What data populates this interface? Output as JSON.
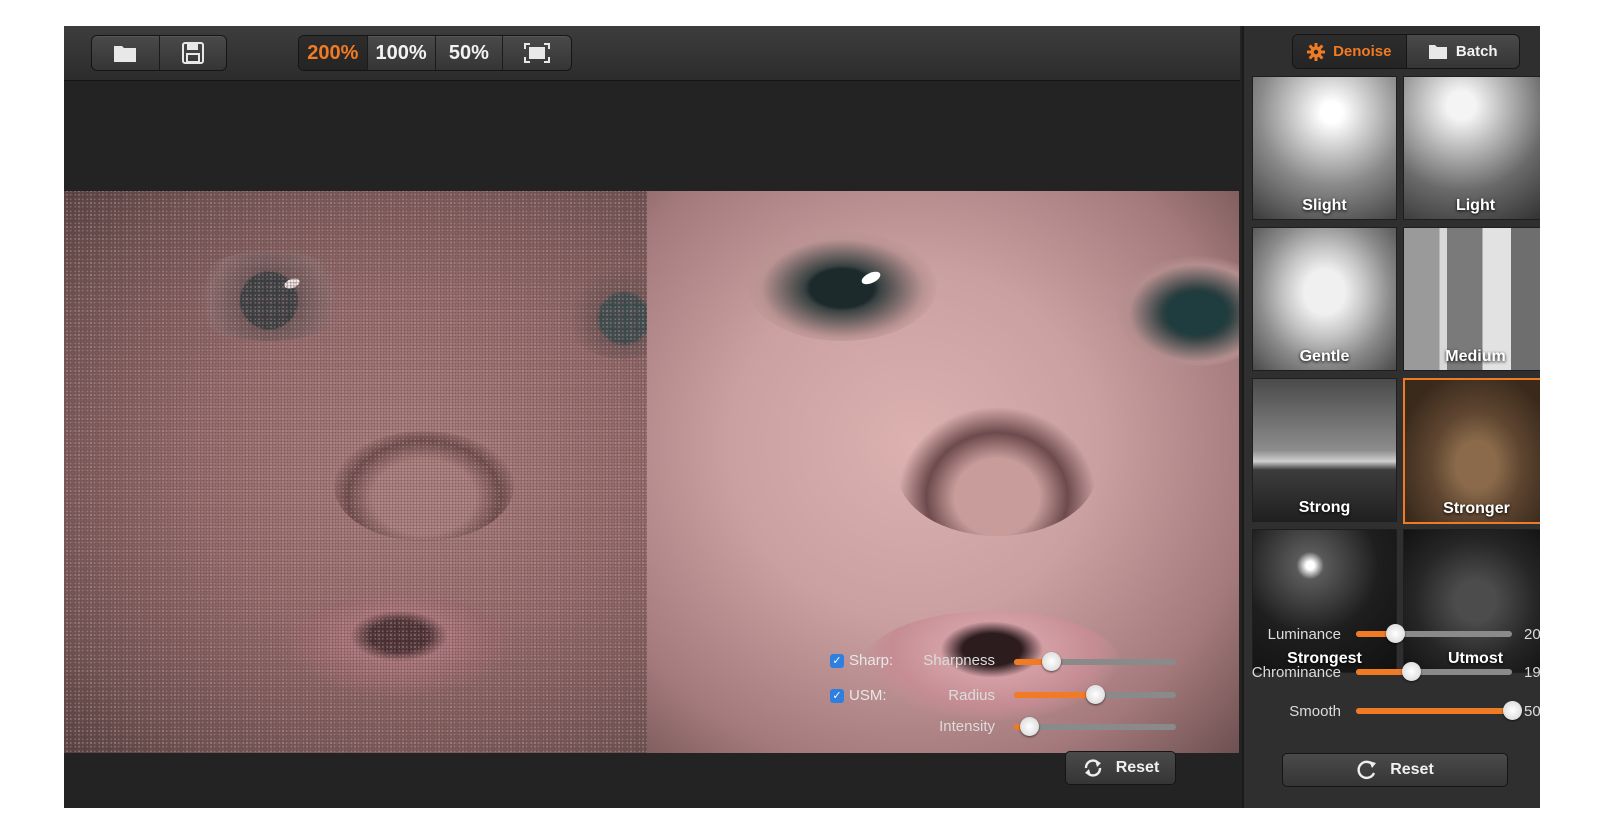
{
  "toolbar": {
    "open_icon": "folder-icon",
    "save_icon": "save-disk-icon",
    "zoom_options": [
      "200%",
      "100%",
      "50%"
    ],
    "zoom_selected": "200%",
    "fit_icon": "fit-screen-icon"
  },
  "tabs": [
    {
      "label": "Denoise",
      "icon": "gear-icon",
      "active": true
    },
    {
      "label": "Batch",
      "icon": "folder-icon",
      "active": false
    }
  ],
  "presets": [
    {
      "name": "Slight"
    },
    {
      "name": "Light"
    },
    {
      "name": "Gentle"
    },
    {
      "name": "Medium"
    },
    {
      "name": "Strong"
    },
    {
      "name": "Stronger",
      "selected": true
    },
    {
      "name": "Strongest"
    },
    {
      "name": "Utmost"
    }
  ],
  "noise_sliders": [
    {
      "label": "Luminance",
      "value": 0.25,
      "value_text": "20"
    },
    {
      "label": "Chrominance",
      "value": 0.35,
      "value_text": "19"
    },
    {
      "label": "Smooth",
      "value": 1.0,
      "value_text": "50"
    }
  ],
  "sharpen": {
    "sharp_label": "Sharp:",
    "usm_label": "USM:",
    "sharp_checked": true,
    "usm_checked": true,
    "sliders": [
      {
        "label": "Sharpness",
        "value": 0.23
      },
      {
        "label": "Radius",
        "value": 0.5
      },
      {
        "label": "Intensity",
        "value": 0.09
      }
    ],
    "reset_label": "Reset"
  },
  "sidebar_reset_label": "Reset",
  "colors": {
    "accent": "#f07b24",
    "checkbox": "#2f7fe0"
  }
}
